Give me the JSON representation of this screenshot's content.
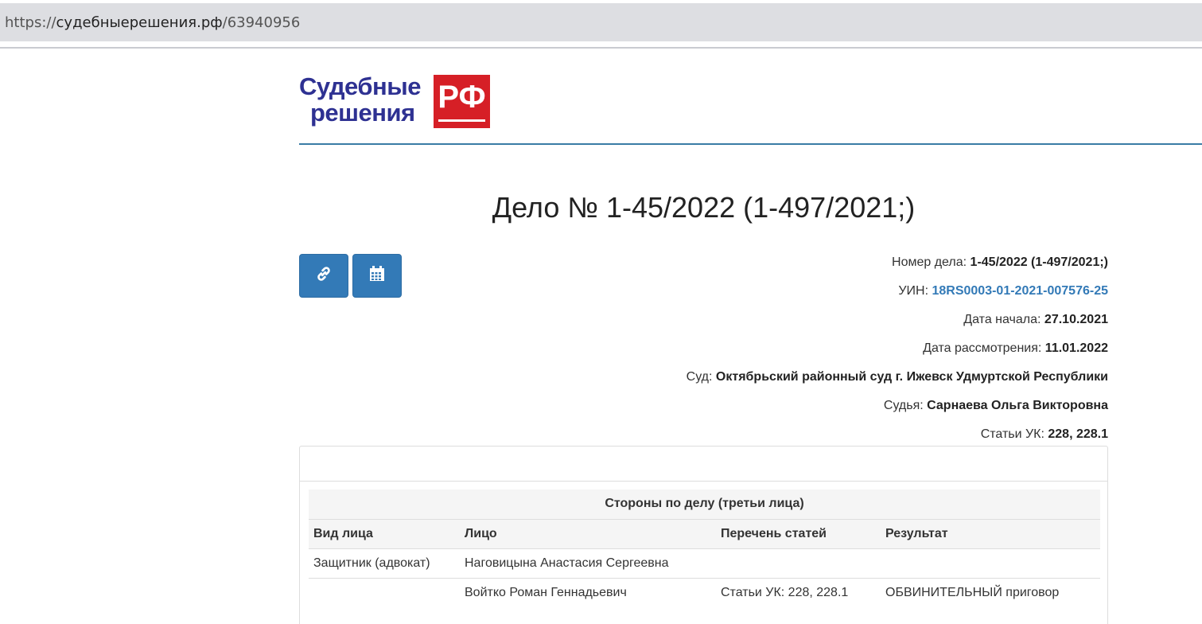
{
  "browser": {
    "url_scheme": "https://",
    "url_host": "судебныерешения.рф",
    "url_path": "/63940956"
  },
  "logo": {
    "line1": "Судебные",
    "line2": "решения",
    "badge": "РФ"
  },
  "case": {
    "title": "Дело № 1-45/2022 (1-497/2021;)"
  },
  "buttons": {
    "link_icon": "link-icon",
    "calendar_icon": "calendar-icon"
  },
  "info": {
    "number_label": "Номер дела:",
    "number_value": "1-45/2022 (1-497/2021;)",
    "uin_label": "УИН:",
    "uin_value": "18RS0003-01-2021-007576-25",
    "start_label": "Дата начала:",
    "start_value": "27.10.2021",
    "review_label": "Дата рассмотрения:",
    "review_value": "11.01.2022",
    "court_label": "Суд:",
    "court_value": "Октябрьский районный суд г. Ижевск Удмуртской Республики",
    "judge_label": "Судья:",
    "judge_value": "Сарнаева Ольга Викторовна",
    "articles_label": "Статьи УК:",
    "articles_value": "228, 228.1"
  },
  "parties": {
    "caption": "Стороны по делу (третьи лица)",
    "columns": [
      "Вид лица",
      "Лицо",
      "Перечень статей",
      "Результат"
    ],
    "rows": [
      [
        "Защитник (адвокат)",
        "Наговицына Анастасия Сергеевна",
        "",
        ""
      ],
      [
        "",
        "Войтко Роман Геннадьевич",
        "Статьи УК: 228, 228.1",
        "ОБВИНИТЕЛЬНЫЙ приговор"
      ]
    ]
  },
  "colors": {
    "primary": "#337ab7",
    "logo_blue": "#2e3192",
    "logo_red": "#d61f26",
    "header_line": "#3a7ca5"
  }
}
